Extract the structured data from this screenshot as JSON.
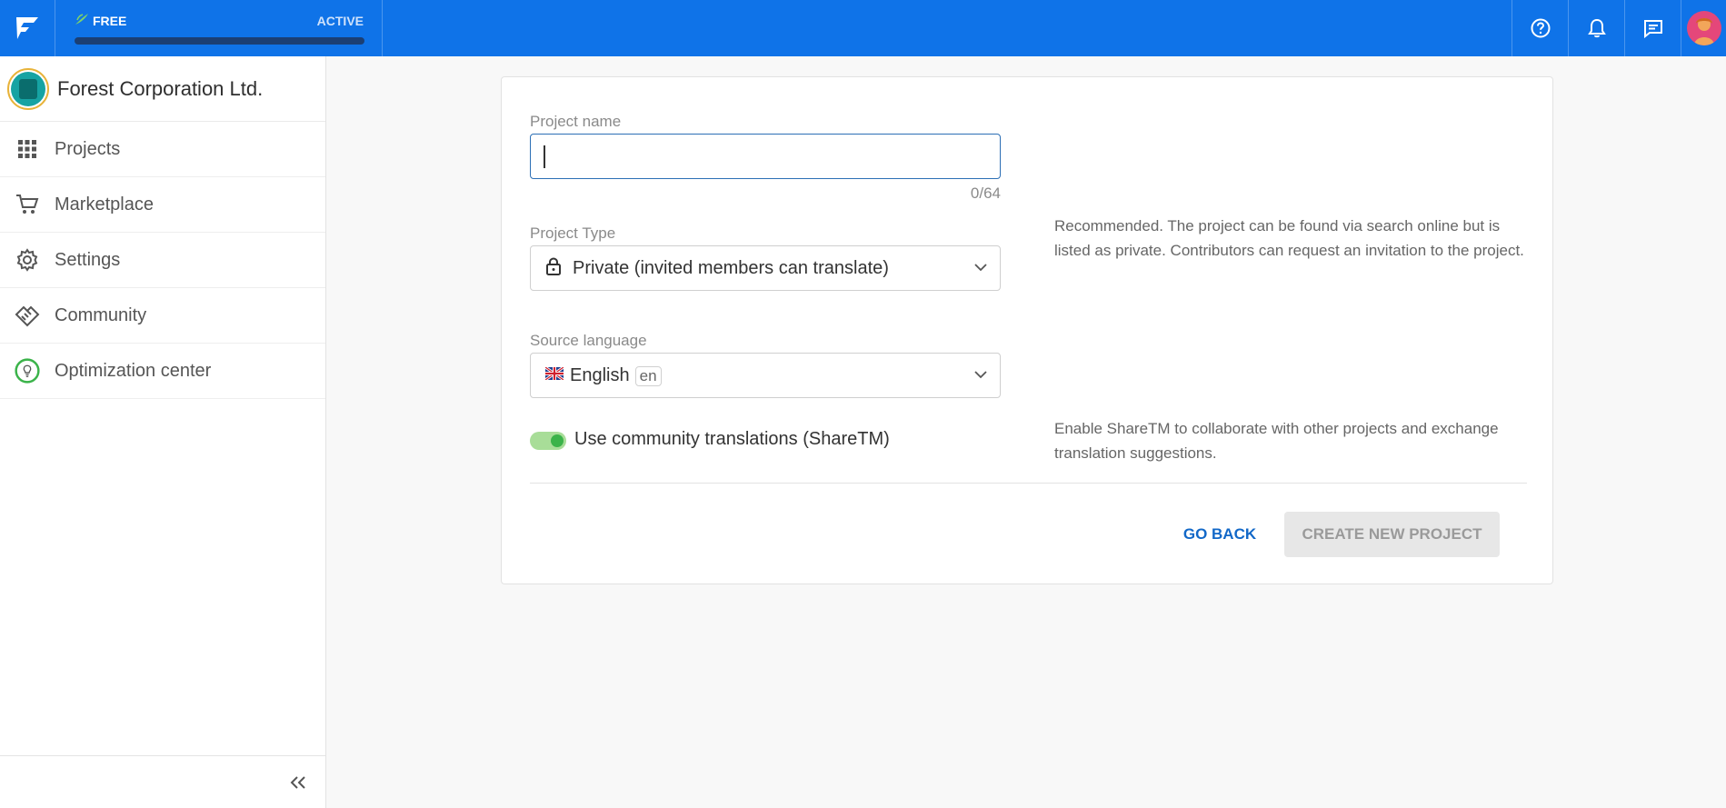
{
  "topbar": {
    "plan_label": "FREE",
    "plan_status": "ACTIVE",
    "icons": [
      "help-icon",
      "bell-icon",
      "chat-icon"
    ],
    "accent_color": "#0f73e8"
  },
  "sidebar": {
    "org_name": "Forest Corporation Ltd.",
    "items": [
      {
        "label": "Projects",
        "icon": "grid-icon"
      },
      {
        "label": "Marketplace",
        "icon": "cart-icon"
      },
      {
        "label": "Settings",
        "icon": "gear-icon"
      },
      {
        "label": "Community",
        "icon": "handshake-icon"
      },
      {
        "label": "Optimization center",
        "icon": "lightbulb-icon"
      }
    ]
  },
  "form": {
    "project_name_label": "Project name",
    "project_name_value": "",
    "project_name_counter": "0/64",
    "project_type_label": "Project Type",
    "project_type_value": "Private (invited members can translate)",
    "project_type_help": "Recommended. The project can be found via search online but is listed as private. Contributors can request an invitation to the project.",
    "source_language_label": "Source language",
    "source_language_value": "English",
    "source_language_code": "en",
    "sharetm_label": "Use community translations (ShareTM)",
    "sharetm_enabled": true,
    "sharetm_help": "Enable ShareTM to collaborate with other projects and exchange translation suggestions.",
    "go_back_label": "GO BACK",
    "create_label": "CREATE NEW PROJECT"
  }
}
